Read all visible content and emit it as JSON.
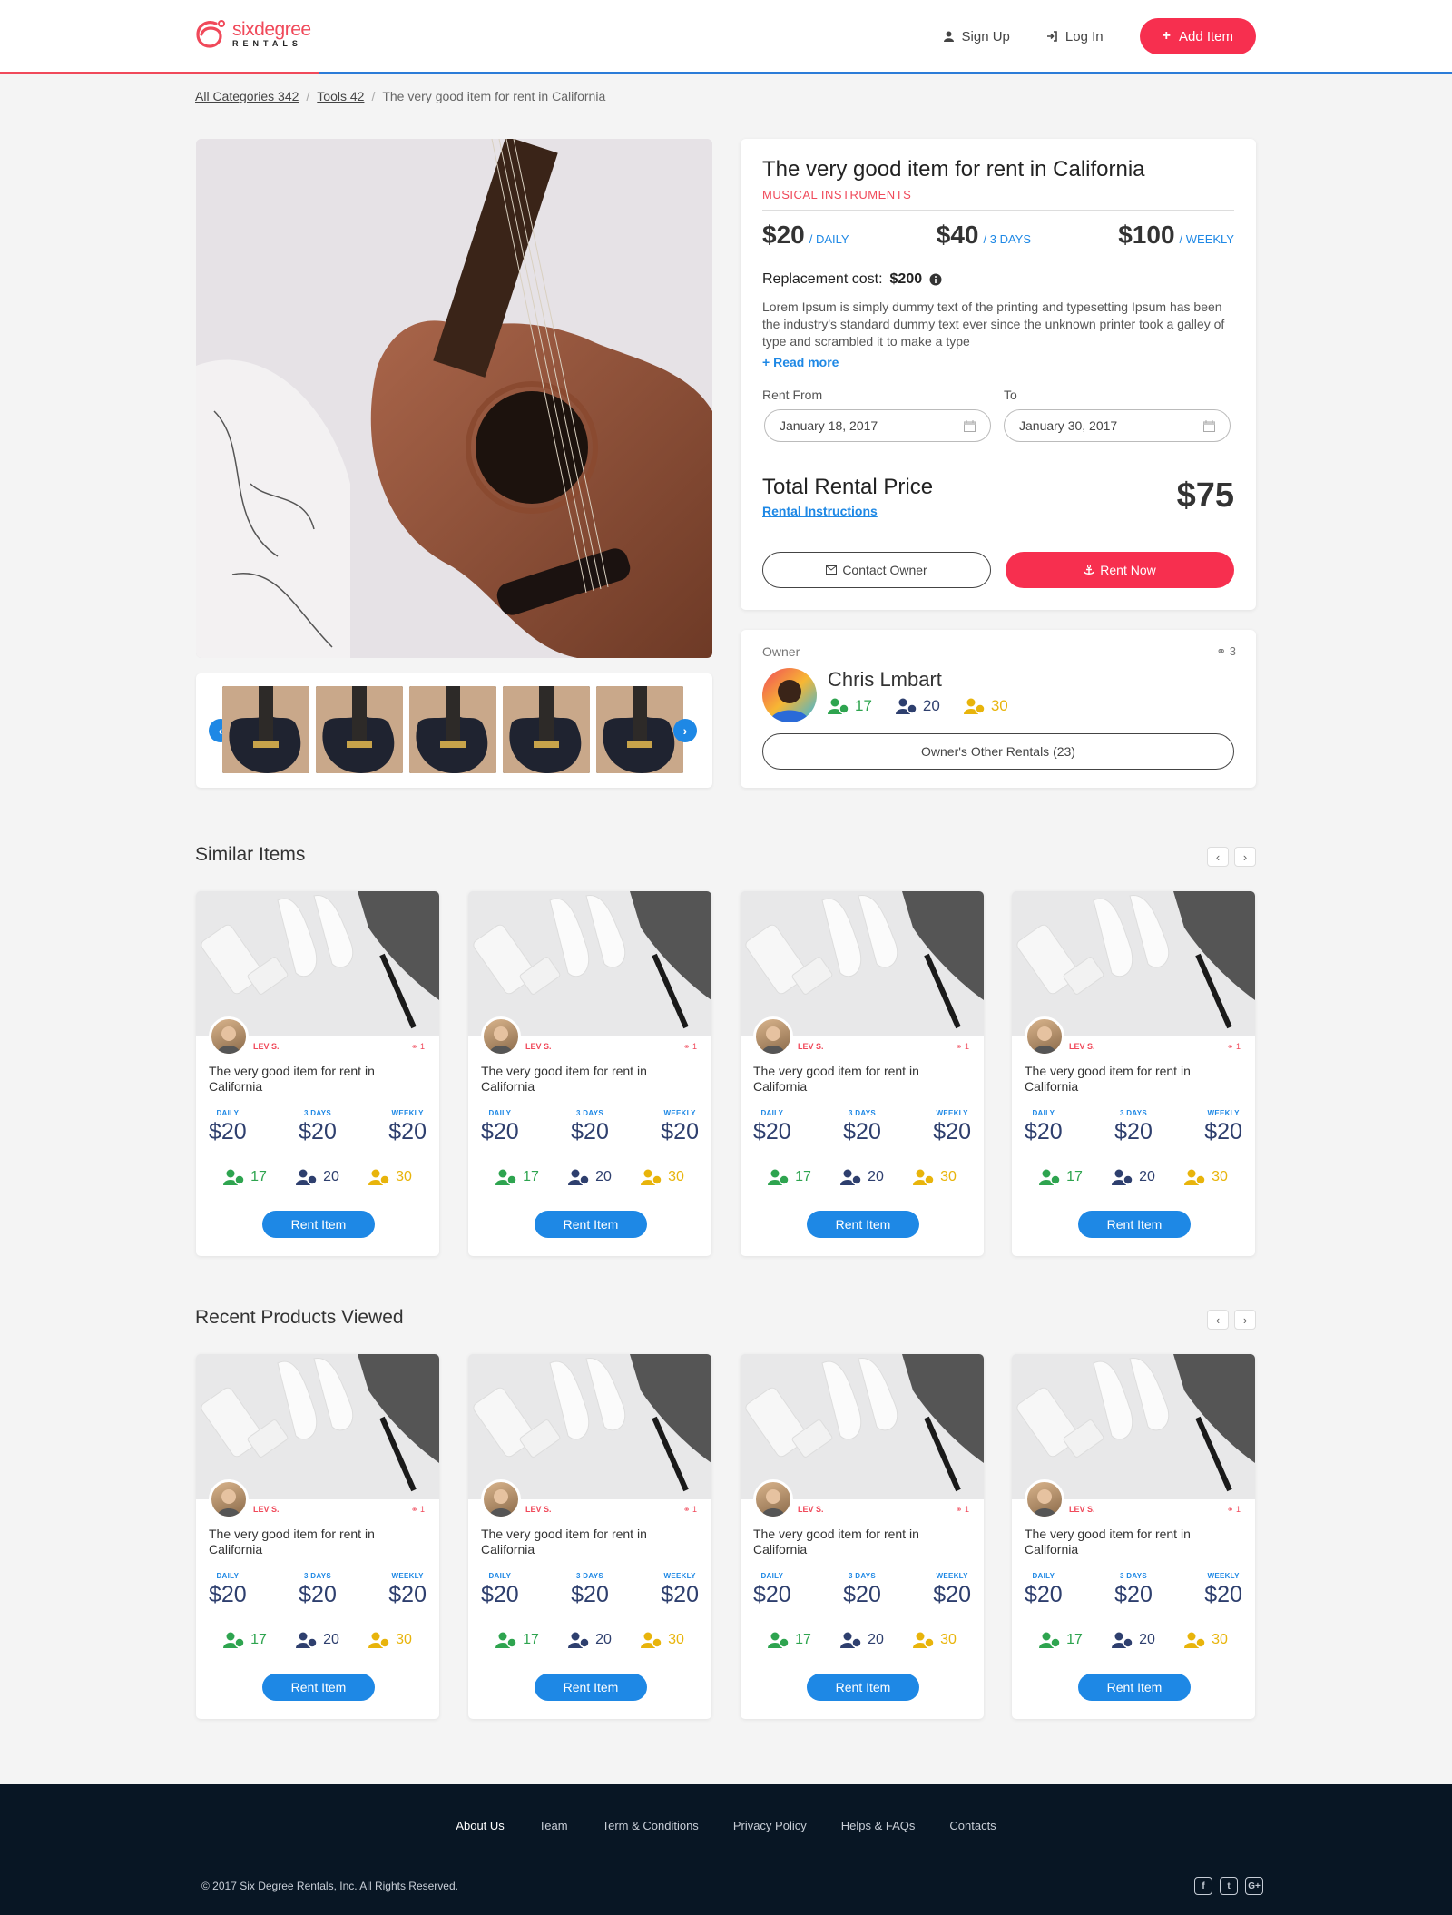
{
  "header": {
    "logo_top": "sixdegree",
    "logo_bottom": "RENTALS",
    "signup": "Sign Up",
    "login": "Log In",
    "add_item": "Add Item"
  },
  "breadcrumb": {
    "cat1": "All Categories  342",
    "cat2": "Tools 42",
    "current": "The very good item for rent in California"
  },
  "item": {
    "title": "The very good item for rent in California",
    "category": "MUSICAL INSTRUMENTS",
    "prices": [
      {
        "amount": "$20",
        "period": "/ DAILY"
      },
      {
        "amount": "$40",
        "period": "/ 3 DAYS"
      },
      {
        "amount": "$100",
        "period": "/ WEEKLY"
      }
    ],
    "replacement_label": "Replacement cost:",
    "replacement_value": "$200",
    "description": "Lorem Ipsum is simply dummy text of the printing and typesetting Ipsum has been the industry's standard dummy text ever since the unknown printer took a galley of type and scrambled it to make a type",
    "read_more": "Read more",
    "rent_from_label": "Rent From",
    "rent_from_value": "January 18, 2017",
    "to_label": "To",
    "to_value": "January 30, 2017",
    "total_label": "Total Rental Price",
    "instructions": "Rental Instructions",
    "total_value": "$75",
    "contact_owner": "Contact Owner",
    "rent_now": "Rent Now"
  },
  "owner": {
    "label": "Owner",
    "count": "3",
    "name": "Chris Lmbart",
    "stat_green": "17",
    "stat_navy": "20",
    "stat_yellow": "30",
    "other_rentals": "Owner's Other Rentals (23)"
  },
  "similar": {
    "title": "Similar Items"
  },
  "recent": {
    "title": "Recent Products Viewed"
  },
  "product": {
    "seller": "LEV S.",
    "count": "1",
    "title": "The very good item for rent in California",
    "daily_label": "DAILY",
    "days_label": "3 DAYS",
    "weekly_label": "WEEKLY",
    "daily": "$20",
    "days": "$20",
    "weekly": "$20",
    "stat_green": "17",
    "stat_navy": "20",
    "stat_yellow": "30",
    "button": "Rent Item"
  },
  "footer": {
    "links": [
      "About Us",
      "Team",
      "Term & Conditions",
      "Privacy Policy",
      "Helps & FAQs",
      "Contacts"
    ],
    "copyright": "© 2017  Six Degree Rentals, Inc. All Rights Reserved.",
    "social": [
      "f",
      "t",
      "G+"
    ]
  },
  "colors": {
    "brand_red": "#f72f4f",
    "brand_blue": "#1e88e5",
    "stat_green": "#2ea44f",
    "stat_navy": "#2e3f6e",
    "stat_yellow": "#e8b40b",
    "footer_bg": "#081624"
  }
}
